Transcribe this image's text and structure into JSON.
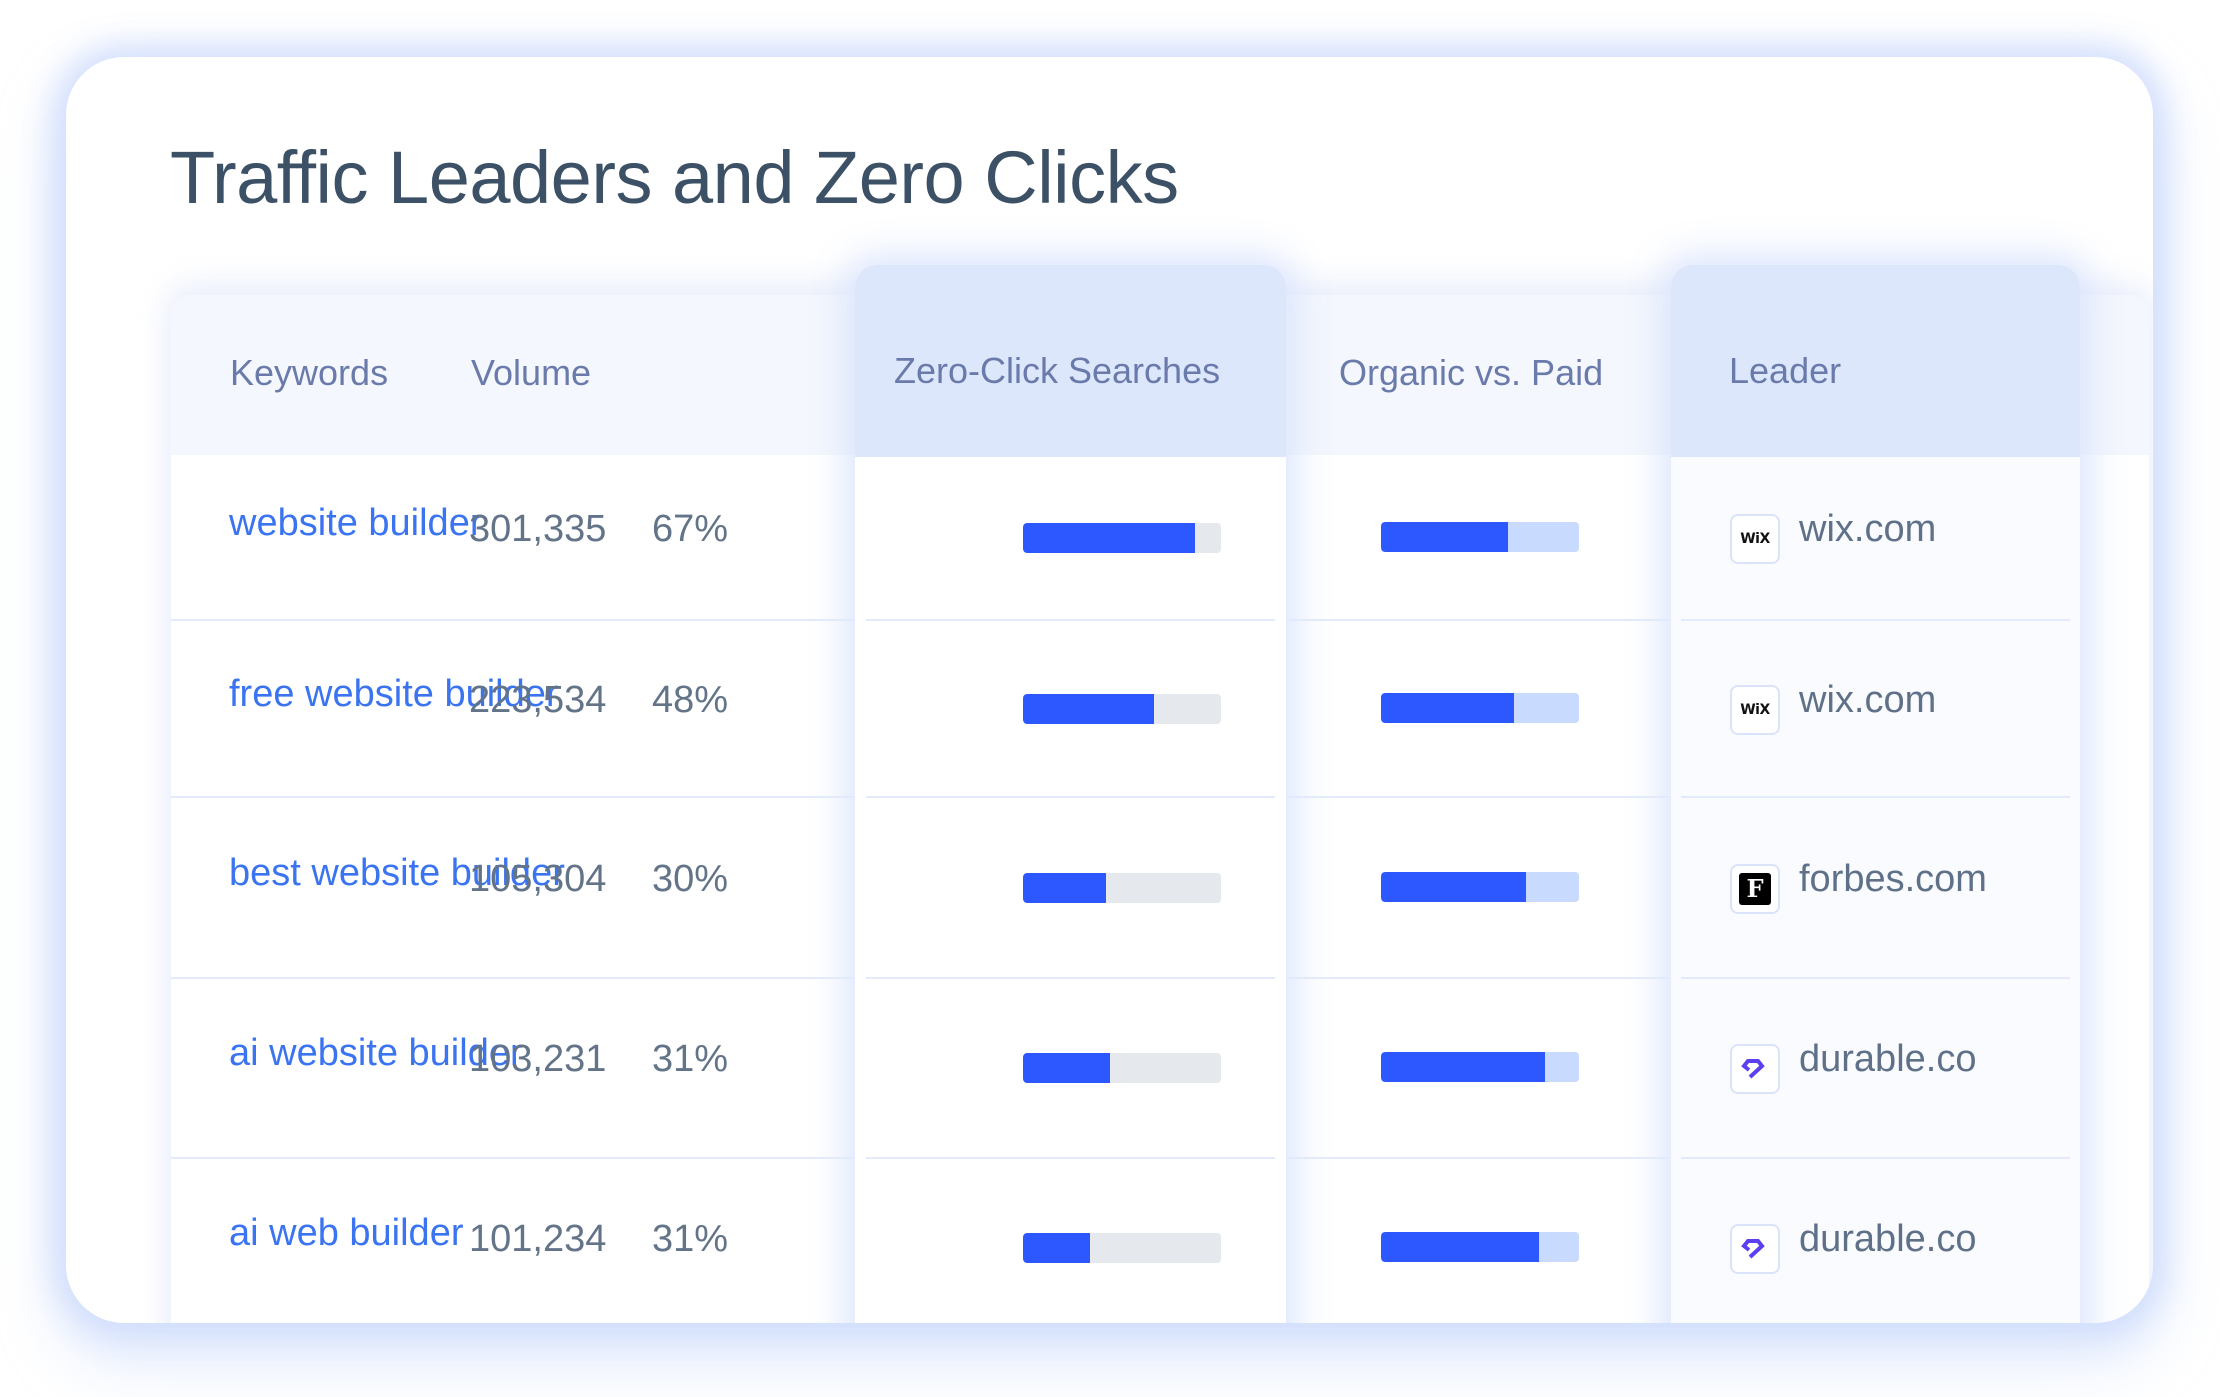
{
  "title": "Traffic Leaders and Zero Clicks",
  "columns": {
    "keywords": "Keywords",
    "volume": "Volume",
    "zero_click": "Zero-Click Searches",
    "organic_vs_paid": "Organic vs. Paid",
    "leader": "Leader"
  },
  "colors": {
    "accent": "#2d58ff",
    "keyword_link": "#3b74f0",
    "zero_track": "#e5e9ee",
    "paid_track": "#c8dafd",
    "highlight_header": "#dde7fc"
  },
  "rows": [
    {
      "keyword": "website builder",
      "volume": "301,335",
      "zero_click_label": "67%",
      "zero_click_bar_fill": 0.87,
      "organic_share": 0.64,
      "leader": {
        "name": "wix.com",
        "icon": "wix-logo-icon",
        "glyph": "WiX"
      }
    },
    {
      "keyword": "free website builder",
      "volume": "223,534",
      "zero_click_label": "48%",
      "zero_click_bar_fill": 0.66,
      "organic_share": 0.67,
      "leader": {
        "name": "wix.com",
        "icon": "wix-logo-icon",
        "glyph": "WiX"
      }
    },
    {
      "keyword": "best website builder",
      "volume": "105,304",
      "zero_click_label": "30%",
      "zero_click_bar_fill": 0.42,
      "organic_share": 0.73,
      "leader": {
        "name": "forbes.com",
        "icon": "forbes-logo-icon",
        "glyph": "F"
      }
    },
    {
      "keyword": "ai website builder",
      "volume": "103,231",
      "zero_click_label": "31%",
      "zero_click_bar_fill": 0.44,
      "organic_share": 0.83,
      "leader": {
        "name": "durable.co",
        "icon": "durable-logo-icon",
        "glyph": ""
      }
    },
    {
      "keyword": "ai web builder",
      "volume": "101,234",
      "zero_click_label": "31%",
      "zero_click_bar_fill": 0.34,
      "organic_share": 0.8,
      "leader": {
        "name": "durable.co",
        "icon": "durable-logo-icon",
        "glyph": ""
      }
    }
  ]
}
